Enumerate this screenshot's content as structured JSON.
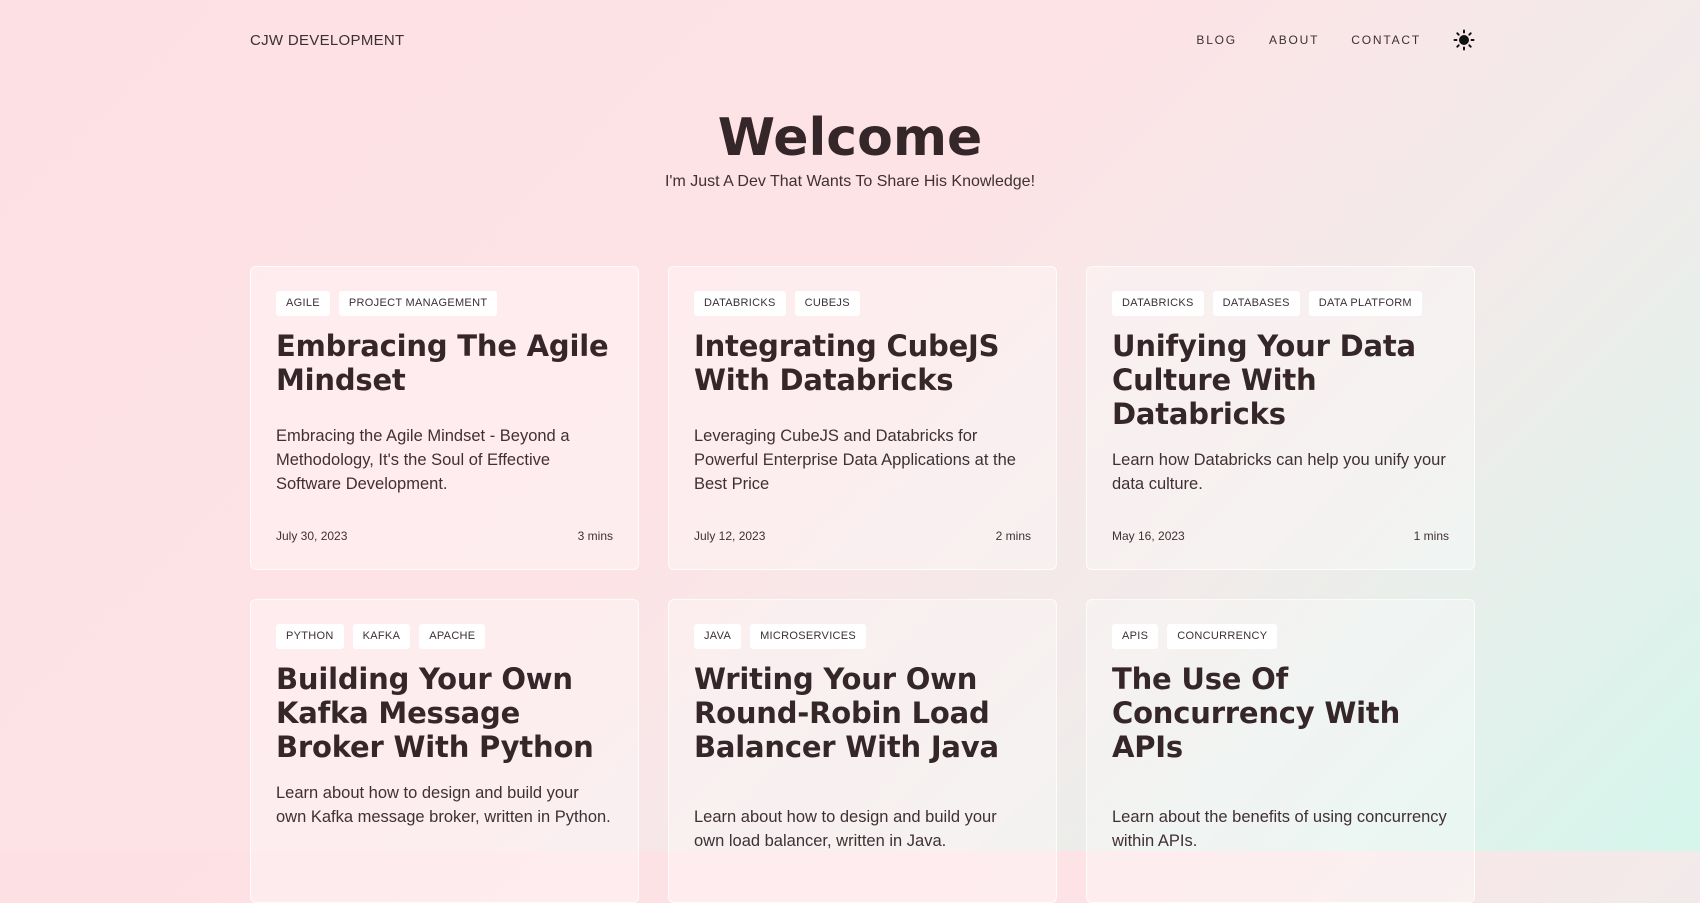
{
  "header": {
    "brand": "CJW DEVELOPMENT",
    "nav": [
      "BLOG",
      "ABOUT",
      "CONTACT"
    ],
    "theme_icon": "sun-icon"
  },
  "hero": {
    "title": "Welcome",
    "subtitle": "I'm Just A Dev That Wants To Share His Knowledge!"
  },
  "posts": [
    {
      "tags": [
        "AGILE",
        "PROJECT MANAGEMENT"
      ],
      "title": "Embracing The Agile Mindset",
      "description": "Embracing the Agile Mindset - Beyond a Methodology, It's the Soul of Effective Software Development.",
      "date": "July 30, 2023",
      "read_time": "3 mins"
    },
    {
      "tags": [
        "DATABRICKS",
        "CUBEJS"
      ],
      "title": "Integrating CubeJS With Databricks",
      "description": "Leveraging CubeJS and Databricks for Powerful Enterprise Data Applications at the Best Price",
      "date": "July 12, 2023",
      "read_time": "2 mins"
    },
    {
      "tags": [
        "DATABRICKS",
        "DATABASES",
        "DATA PLATFORM"
      ],
      "title": "Unifying Your Data Culture With Databricks",
      "description": "Learn how Databricks can help you unify your data culture.",
      "date": "May 16, 2023",
      "read_time": "1 mins"
    },
    {
      "tags": [
        "PYTHON",
        "KAFKA",
        "APACHE"
      ],
      "title": "Building Your Own Kafka Message Broker With Python",
      "description": "Learn about how to design and build your own Kafka message broker, written in Python.",
      "date": "",
      "read_time": ""
    },
    {
      "tags": [
        "JAVA",
        "MICROSERVICES"
      ],
      "title": "Writing Your Own Round-Robin Load Balancer With Java",
      "description": "Learn about how to design and build your own load balancer, written in Java.",
      "date": "",
      "read_time": ""
    },
    {
      "tags": [
        "APIS",
        "CONCURRENCY"
      ],
      "title": "The Use Of Concurrency With APIs",
      "description": "Learn about the benefits of using concurrency within APIs.",
      "date": "",
      "read_time": ""
    }
  ]
}
